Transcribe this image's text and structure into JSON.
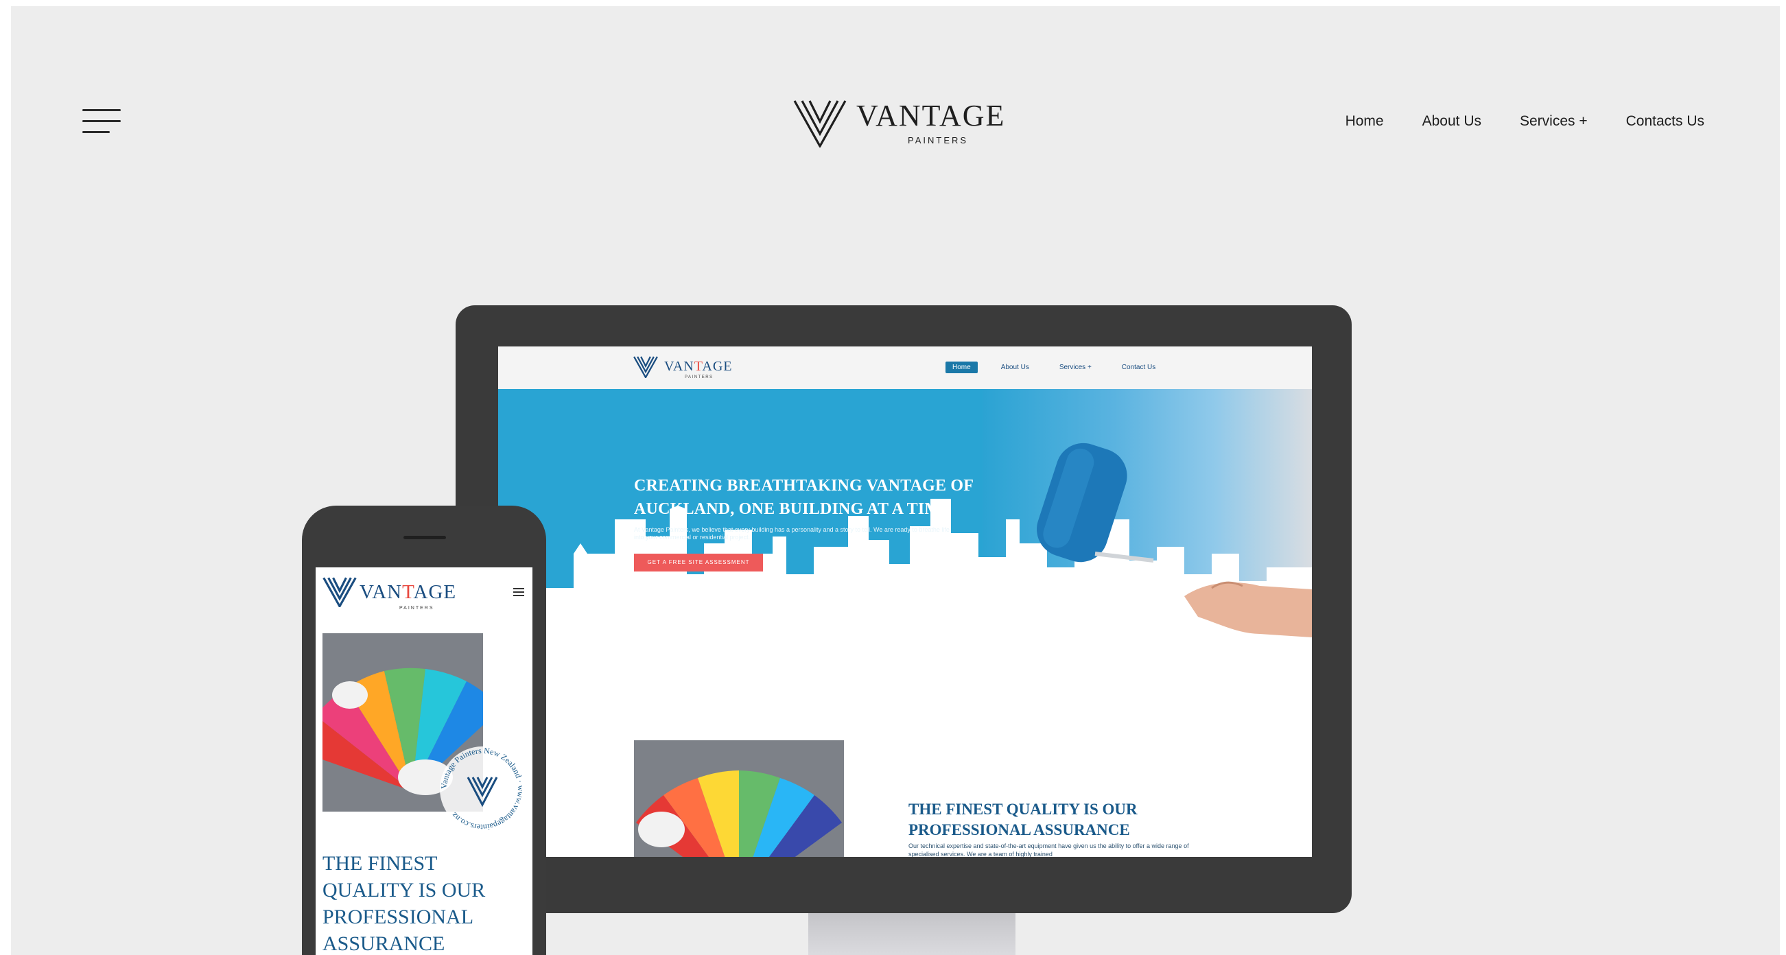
{
  "site": {
    "brand": "VANTAGE",
    "brand_sub": "PAINTERS",
    "nav": [
      "Home",
      "About Us",
      "Services +",
      "Contacts Us"
    ]
  },
  "desktop_screen": {
    "brand_pre": "VAN",
    "brand_t": "T",
    "brand_post": "AGE",
    "brand_sub": "PAINTERS",
    "nav": [
      "Home",
      "About Us",
      "Services +",
      "Contact Us"
    ],
    "hero_title": "CREATING BREATHTAKING VANTAGE OF AUCKLAND, ONE BUILDING AT A TIME",
    "hero_desc": "At Vantage Painters, we believe that every building has a personality and a story to tell. We are ready to breathe life into your commercial or residential project.",
    "cta": "GET A FREE SITE ASSESSMENT",
    "section_title": "THE FINEST QUALITY IS OUR PROFESSIONAL ASSURANCE",
    "section_text": "Our technical expertise and state-of-the-art equipment have given us the ability to offer a wide range of specialised services. We are a team of highly trained"
  },
  "mobile_screen": {
    "brand_pre": "VAN",
    "brand_t": "T",
    "brand_post": "AGE",
    "brand_sub": "PAINTERS",
    "seal_text": "Vantage Painters New Zealand · www.vantagepainters.co.nz",
    "title": "THE FINEST QUALITY IS OUR PROFESSIONAL ASSURANCE"
  },
  "colors": {
    "canvas_bg": "#ededed",
    "brand_blue": "#1a4d80",
    "accent_red": "#e8473e",
    "hero_blue": "#29a4d3",
    "cta_red": "#ee5a5a",
    "device_frame": "#3a3a3a"
  },
  "icons": [
    "hamburger-menu-icon",
    "vantage-v-logo-icon",
    "phone-menu-icon",
    "seal-badge-icon"
  ]
}
